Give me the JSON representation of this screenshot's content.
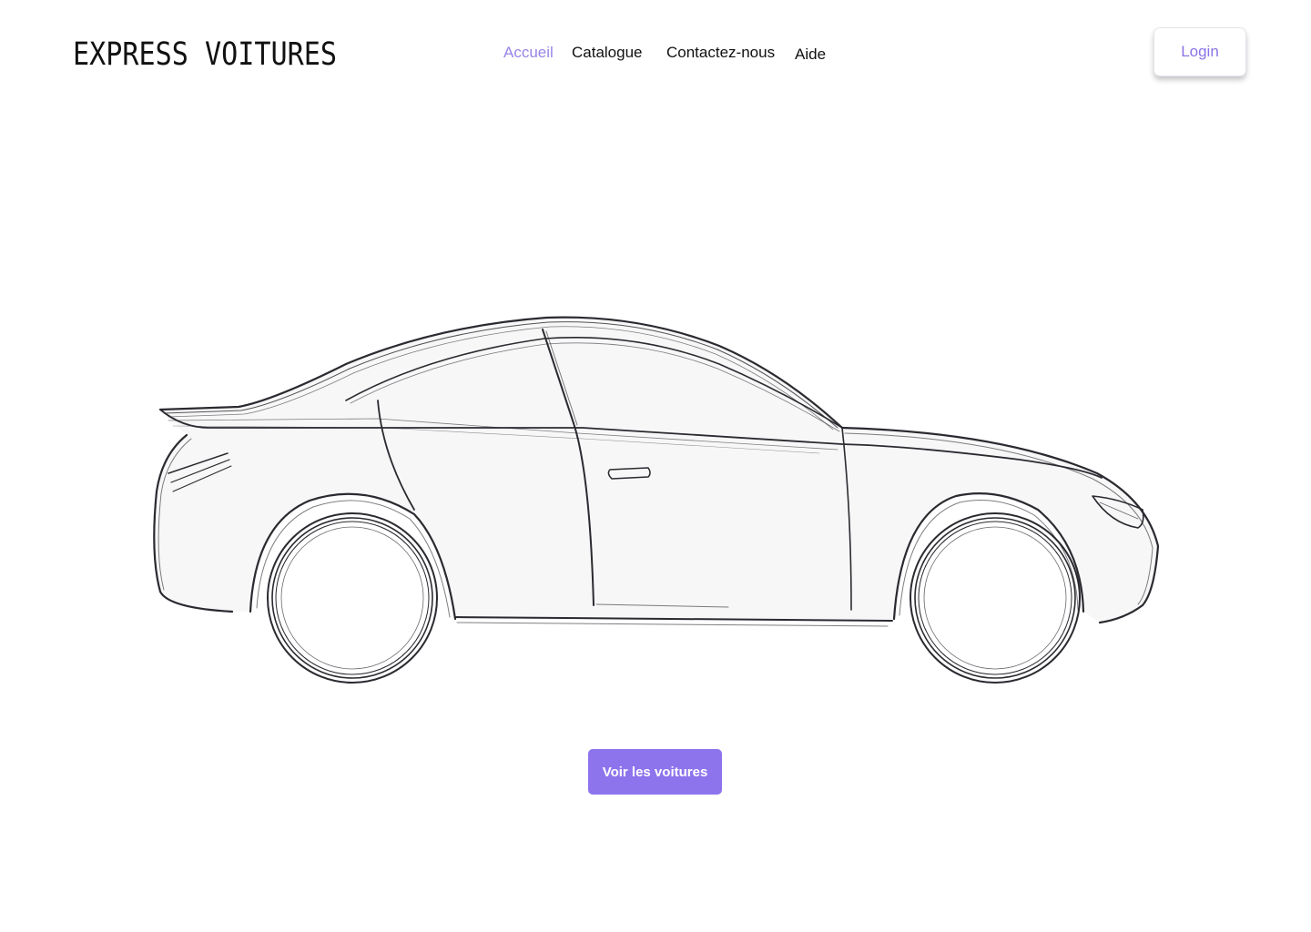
{
  "header": {
    "logo_text": "EXPRESS VOITURES",
    "nav": {
      "home": "Accueil",
      "catalog": "Catalogue",
      "contact": "Contactez-nous",
      "help": "Aide"
    },
    "login_label": "Login"
  },
  "hero": {
    "cta_label": "Voir les voitures"
  },
  "colors": {
    "accent": "#8d74ed",
    "active_link": "#9a84e6",
    "text": "#111111",
    "background": "#ffffff"
  },
  "icons": {
    "hero_illustration": "car-sketch-side-view"
  }
}
